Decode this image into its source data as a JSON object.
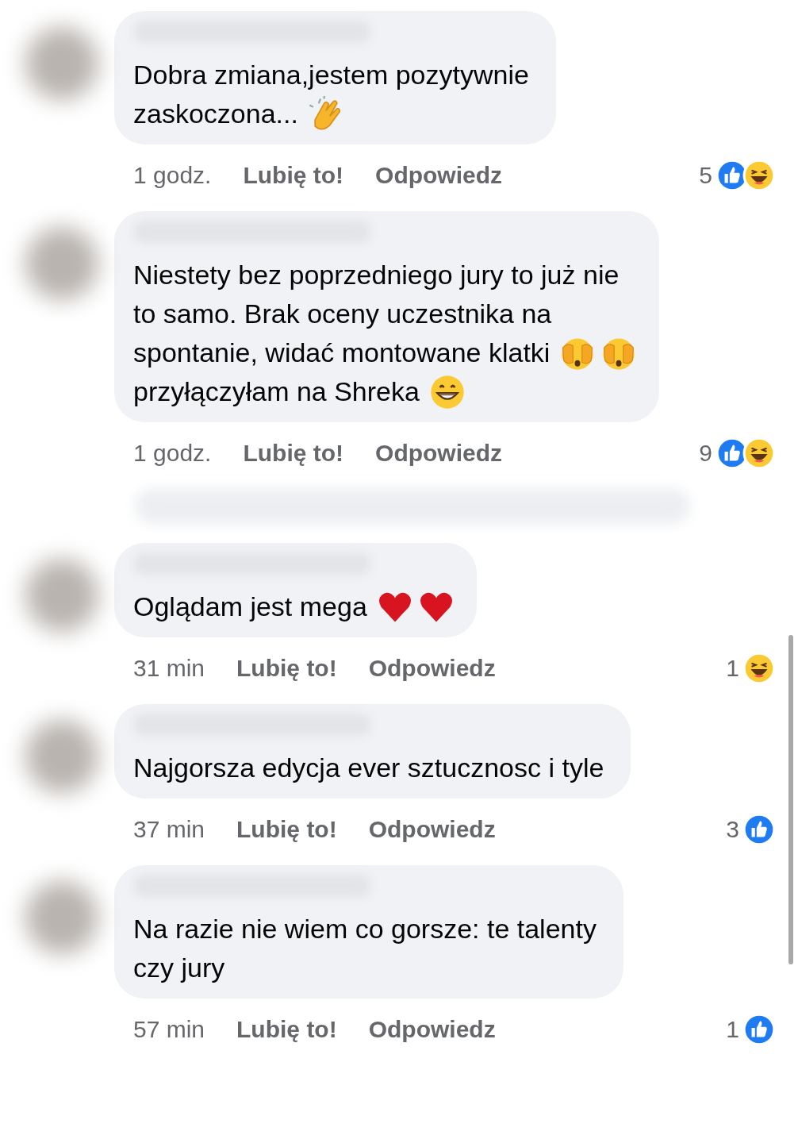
{
  "comments": [
    {
      "kind": "comment",
      "lines": [
        [
          {
            "kind": "text",
            "text": "Dobra zmiana,jestem pozytywnie"
          }
        ],
        [
          {
            "kind": "text",
            "text": "zaskoczona..."
          },
          {
            "kind": "clap"
          }
        ]
      ],
      "time": "1 godz.",
      "like": "Lubię to!",
      "reply": "Odpowiedz",
      "count": "5",
      "reactions": [
        {
          "kind": "like"
        },
        {
          "kind": "haha"
        }
      ]
    },
    {
      "kind": "comment",
      "lines": [
        [
          {
            "kind": "text",
            "text": "Niestety bez poprzedniego jury to już nie"
          }
        ],
        [
          {
            "kind": "text",
            "text": "to samo. Brak oceny uczestnika na"
          }
        ],
        [
          {
            "kind": "text",
            "text": "spontanie, widać montowane klatki"
          },
          {
            "kind": "cover"
          },
          {
            "kind": "cover"
          }
        ],
        [
          {
            "kind": "text",
            "text": "przyłączyłam  na Shreka"
          },
          {
            "kind": "grin"
          }
        ]
      ],
      "time": "1 godz.",
      "like": "Lubię to!",
      "reply": "Odpowiedz",
      "count": "9",
      "reactions": [
        {
          "kind": "like"
        },
        {
          "kind": "haha"
        }
      ]
    },
    {
      "kind": "blurred_row"
    },
    {
      "kind": "comment",
      "lines": [
        [
          {
            "kind": "text",
            "text": "Oglądam jest mega"
          },
          {
            "kind": "heart"
          },
          {
            "kind": "heart"
          }
        ]
      ],
      "time": "31 min",
      "like": "Lubię to!",
      "reply": "Odpowiedz",
      "count": "1",
      "reactions": [
        {
          "kind": "haha"
        }
      ]
    },
    {
      "kind": "comment",
      "lines": [
        [
          {
            "kind": "text",
            "text": "Najgorsza edycja ever sztucznosc i tyle"
          }
        ]
      ],
      "time": "37 min",
      "like": "Lubię to!",
      "reply": "Odpowiedz",
      "count": "3",
      "reactions": [
        {
          "kind": "like"
        }
      ]
    },
    {
      "kind": "comment",
      "lines": [
        [
          {
            "kind": "text",
            "text": "Na razie nie wiem co gorsze: te talenty"
          }
        ],
        [
          {
            "kind": "text",
            "text": "czy jury"
          }
        ]
      ],
      "time": "57 min",
      "like": "Lubię to!",
      "reply": "Odpowiedz",
      "count": "1",
      "reactions": [
        {
          "kind": "like"
        }
      ]
    }
  ]
}
